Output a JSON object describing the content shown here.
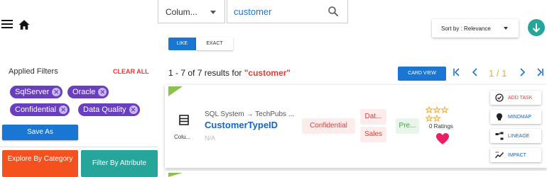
{
  "header": {
    "type_select": {
      "value": "Colum..."
    },
    "search": {
      "value": "customer"
    },
    "sort": {
      "label": "Sort by : Relevance"
    },
    "match_modes": {
      "like": "LIKE",
      "exact": "EXACT",
      "active": "like"
    }
  },
  "filters": {
    "title": "Applied Filters",
    "clear_all": "CLEAR ALL",
    "chips": [
      "SqlServer",
      "Oracle",
      "Confidential",
      "Data Quality"
    ],
    "save_as": "Save As",
    "explore_by_category": "Explore By Category",
    "filter_by_attribute": "Filter By Attribute"
  },
  "results": {
    "summary_prefix": "1 - 7 of 7 results for ",
    "query": "\"customer\"",
    "card_view": "CARD VIEW",
    "page": "1 / 1"
  },
  "card": {
    "type_label": "Colu...",
    "breadcrumb": "SQL System → TechPubs ...",
    "name": "CustomerTypeID",
    "description": "N/A",
    "classification": "Confidential",
    "tags": [
      "Dat...",
      "Sales"
    ],
    "status": "Pre...",
    "ratings": "0 Ratings",
    "actions": [
      "ADD TASK",
      "MINDMAP",
      "LINEAGE",
      "IMPACT"
    ]
  },
  "colors": {
    "primary": "#1976d2",
    "chip": "#6a3fbf",
    "accent_red": "#e53935",
    "teal": "#26a69a",
    "orange": "#f4511e",
    "gold": "#f9a825",
    "green_corner": "#8bc34a"
  }
}
